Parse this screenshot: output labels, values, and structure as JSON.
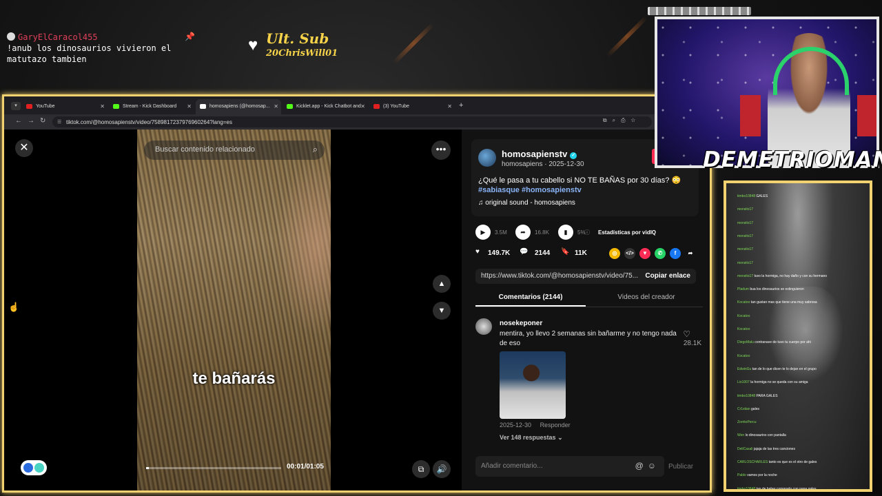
{
  "overlay": {
    "chat_user": "GaryElCaracol455",
    "chat_message": "!anub los dinosaurios vivieron el matutazo tambien",
    "last_sub_title": "Ult. Sub",
    "last_sub_name": "20ChrisWill01",
    "streamer_name": "DEMETRIOMAN"
  },
  "browser": {
    "tabs": [
      {
        "label": "YouTube",
        "color": "#e02020"
      },
      {
        "label": "Stream - Kick Dashboard",
        "color": "#53fc18"
      },
      {
        "label": "homosapiens (@homosap...",
        "color": "#ffffff",
        "active": true
      },
      {
        "label": "Kicklet.app - Kick Chatbot and",
        "color": "#53fc18"
      },
      {
        "label": "(3) YouTube",
        "color": "#e02020"
      }
    ],
    "url": "tiktok.com/@homosapienstv/video/7589817237976960264?lang=es"
  },
  "player": {
    "search_placeholder": "Buscar contenido relacionado",
    "caption": "te bañarás",
    "timecode": "00:01/01:05",
    "progress": 0.02
  },
  "post": {
    "author": "homosapienstv",
    "author_sub": "homosapiens · 2025-12-30",
    "description": "¿Qué le pasa a tu cabello si NO TE BAÑAS por 30 días? 😳",
    "hashtags": "#sabiasque #homosapienstv",
    "sound": "original sound - homosapiens",
    "stats_label": "Estadísticas por vidIQ",
    "stat_views": "3.5M",
    "stat_shares": "16.8K",
    "stat_pct": "5%",
    "likes": "149.7K",
    "comments": "2144",
    "saves": "11K",
    "link": "https://www.tiktok.com/@homosapienstv/video/75...",
    "copy_label": "Copiar enlace",
    "tab_comments": "Comentarios (2144)",
    "tab_videos": "Videos del creador"
  },
  "comment": {
    "user": "nosekeponer",
    "text": "mentira, yo llevo 2 semanas sin bañarme y no tengo nada de eso",
    "likes": "28.1K",
    "date": "2025-12-30",
    "reply": "Responder",
    "view_replies": "Ver 148 respuestas"
  },
  "composer": {
    "placeholder": "Añadir comentario...",
    "post_label": "Publicar"
  },
  "chat_panel": {
    "lines": [
      {
        "user": "timbo10848",
        "text": "GALES"
      },
      {
        "user": "monsito17",
        "text": ""
      },
      {
        "user": "monsito17",
        "text": ""
      },
      {
        "user": "monsito17",
        "text": ""
      },
      {
        "user": "monsito17",
        "text": ""
      },
      {
        "user": "monsito17",
        "text": ""
      },
      {
        "user": "monsito17",
        "text": "tuvo la hormiga, no hay daño y con su hermano"
      },
      {
        "user": "Pladum",
        "text": "bua los dinosaurios se extinguieron"
      },
      {
        "user": "Kocatoo",
        "text": "tan gustan mas que tiene una muy sabrosa"
      },
      {
        "user": "Kocatoo",
        "text": ""
      },
      {
        "user": "Kocatoo",
        "text": ""
      },
      {
        "user": "DiegoMalu",
        "text": "contranave de tuvo tu cuerpo por ahi"
      },
      {
        "user": "Kocatoo",
        "text": ""
      },
      {
        "user": "EdwinGu",
        "text": "tan de lo que dicen te lo dejan en el grupo"
      },
      {
        "user": "Lio1007",
        "text": "la hormiga no se queda con su amiga"
      },
      {
        "user": "timbo10848",
        "text": "PARA GALES"
      },
      {
        "user": "Cr1stian",
        "text": "gales"
      },
      {
        "user": "ZorritoPercu",
        "text": ""
      },
      {
        "user": "Wen",
        "text": "lo dinosaurios con pantalla"
      },
      {
        "user": "DeliCasali",
        "text": "jajaja de las tres canciones"
      },
      {
        "user": "CARLOSCHARLES",
        "text": "tanto es que es el otro de gales"
      },
      {
        "user": "Pablo",
        "text": "vamos por la noche"
      },
      {
        "user": "timbo10848",
        "text": "tan de haber comprado con papa gales"
      }
    ]
  }
}
